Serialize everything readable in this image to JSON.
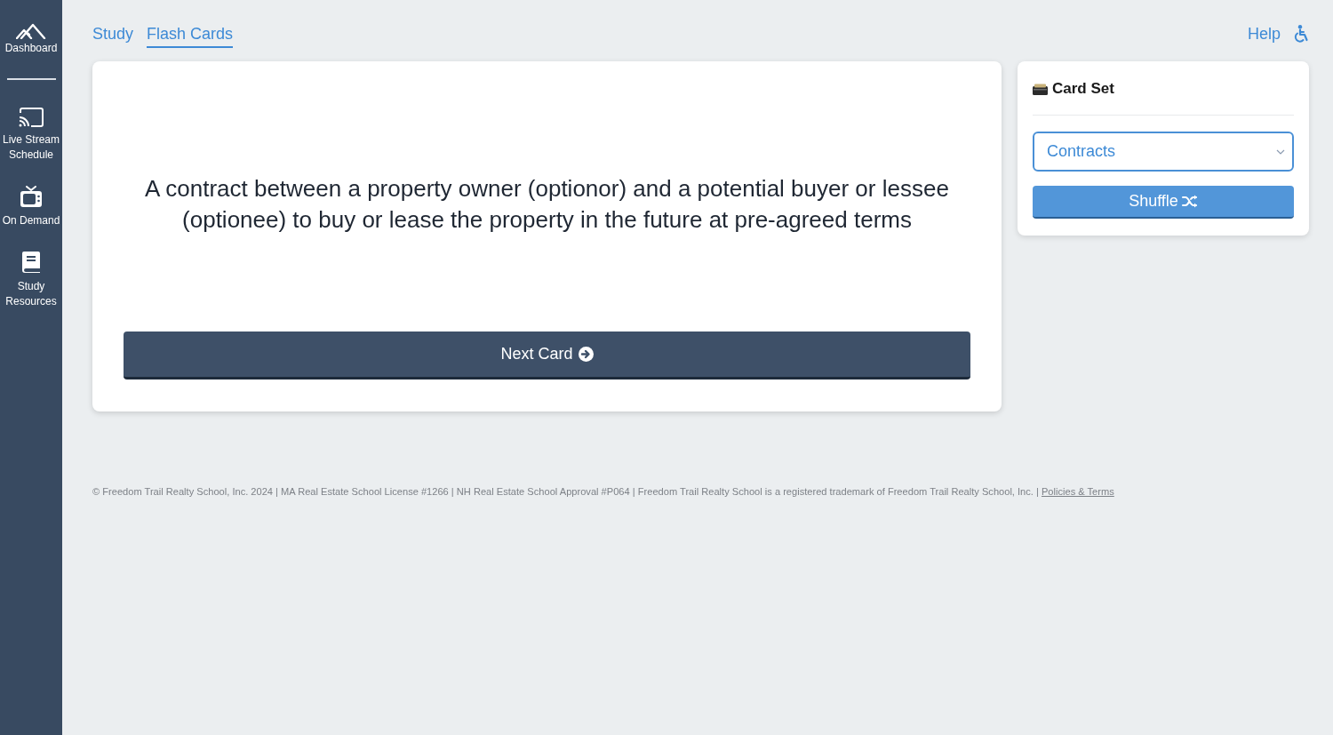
{
  "sidebar": {
    "items": [
      {
        "label": "Dashboard",
        "kind": "logo"
      },
      {
        "label": "Live Stream Schedule",
        "kind": "cast"
      },
      {
        "label": "On Demand",
        "kind": "tv"
      },
      {
        "label": "Study Resources",
        "kind": "book"
      }
    ]
  },
  "tabs": [
    {
      "label": "Study",
      "selected": false
    },
    {
      "label": "Flash Cards",
      "selected": true
    }
  ],
  "header": {
    "help_link": "Help"
  },
  "flash_card": {
    "text": "A contract between a property owner (optionor) and a potential buyer or lessee (optionee) to buy or lease the property in the future at pre-agreed terms",
    "next_button": "Next Card"
  },
  "card_set": {
    "title": "Card Set",
    "select": {
      "value": "Contracts"
    },
    "shuffle_button": "Shuffle"
  },
  "footer": {
    "text": "© Freedom Trail Realty School, Inc. 2024 | MA Real Estate School License #1266 | NH Real Estate School Approval #P064 | Freedom Trail Realty School is a registered trademark of Freedom Trail Realty School, Inc. |",
    "link": "Policies & Terms"
  }
}
